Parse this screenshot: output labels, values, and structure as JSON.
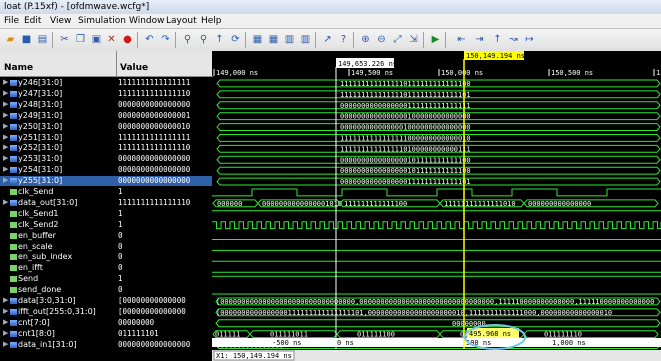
{
  "window": {
    "title": "loat (P.15xf) - [ofdmwave.wcfg*]"
  },
  "menu": [
    "File",
    "Edit",
    "View",
    "Simulation",
    "Window",
    "Layout",
    "Help"
  ],
  "columns": {
    "name": "Name",
    "value": "Value"
  },
  "cursor_time": "150,149.194 ns",
  "secondary_cursor": "149,653.226 ns",
  "ruler_labels": [
    "149,000 ns",
    "149,500 ns",
    "150,000 ns",
    "150,500 ns",
    "151,0"
  ],
  "bottom_ruler": [
    "-500 ns",
    "0 ns",
    "500 ns",
    "1,000 ns"
  ],
  "delta_label": "495.968 ns",
  "x1_label": "X1: 150,149.194 ns",
  "signals": [
    {
      "name": "y246[31:0]",
      "value": "1111111111111111",
      "type": "bus",
      "wave": "1111111111111110111111111111100"
    },
    {
      "name": "y247[31:0]",
      "value": "1111111111111110",
      "type": "bus",
      "wave": "1111111111111110111111111111101"
    },
    {
      "name": "y248[31:0]",
      "value": "0000000000000000",
      "type": "bus",
      "wave": "0000000000000000111111111111111"
    },
    {
      "name": "y249[31:0]",
      "value": "0000000000000001",
      "type": "bus",
      "wave": "0000000000000000100000000000000"
    },
    {
      "name": "y250[31:0]",
      "value": "0000000000000010",
      "type": "bus",
      "wave": "0000000000000001000000000000000"
    },
    {
      "name": "y251[31:0]",
      "value": "1111111111111111",
      "type": "bus",
      "wave": "1111111111111111000000000000010"
    },
    {
      "name": "y252[31:0]",
      "value": "1111111111111110",
      "type": "bus",
      "wave": "1111111111111110100000000000111"
    },
    {
      "name": "y253[31:0]",
      "value": "0000000000000000",
      "type": "bus",
      "wave": "0000000000000000101111111111100"
    },
    {
      "name": "y254[31:0]",
      "value": "0000000000000000",
      "type": "bus",
      "wave": "0000000000000000101111111111100"
    },
    {
      "name": "y255[31:0]",
      "value": "0000000000000000",
      "type": "bus",
      "wave": "0000000000000000111111111111101",
      "selected": true
    },
    {
      "name": "clk_Send",
      "value": "1",
      "type": "bit"
    },
    {
      "name": "data_out[31:0]",
      "value": "1111111111111110",
      "type": "bus",
      "wave": "00000000000000001010 / 111111111111100 / 11111111111111010 / 000000000000"
    },
    {
      "name": "clk_Send1",
      "value": "1",
      "type": "bit"
    },
    {
      "name": "clk_Send2",
      "value": "1",
      "type": "bit"
    },
    {
      "name": "en_buffer",
      "value": "0",
      "type": "bit"
    },
    {
      "name": "en_scale",
      "value": "0",
      "type": "bit"
    },
    {
      "name": "en_sub_index",
      "value": "0",
      "type": "bit"
    },
    {
      "name": "en_ifft",
      "value": "0",
      "type": "bit"
    },
    {
      "name": "Send",
      "value": "1",
      "type": "bit"
    },
    {
      "name": "send_done",
      "value": "0",
      "type": "bit"
    },
    {
      "name": "data[3:0,31:0]",
      "value": "[00000000000000",
      "type": "bus",
      "wave": "[00000000000000000000000000000000,00000000000000000000000000000000,111110000000000000,111110000000000000"
    },
    {
      "name": "ifft_out[255:0,31:0]",
      "value": "[00000000000000",
      "type": "bus",
      "wave": "[0000000000000000111111111111111101,00000000000000000000010,1111111111111000,00000000000000010"
    },
    {
      "name": "cnt[7:0]",
      "value": "00000000",
      "type": "bus",
      "wave": "00000000"
    },
    {
      "name": "cnt1[8:0]",
      "value": "011111101",
      "type": "bus",
      "wave": "011111101"
    },
    {
      "name": "data_in1[31:0]",
      "value": "0000000000000000",
      "type": "bus",
      "wave": "0000000000000000"
    }
  ],
  "cnt1_segments": [
    "011111",
    "011111011",
    "011111100",
    "011111101",
    "011111110"
  ],
  "data_out_segments": [
    "000000",
    "0000000000000001010",
    "111111111111100",
    "11111111111111010",
    "000000000000000"
  ]
}
